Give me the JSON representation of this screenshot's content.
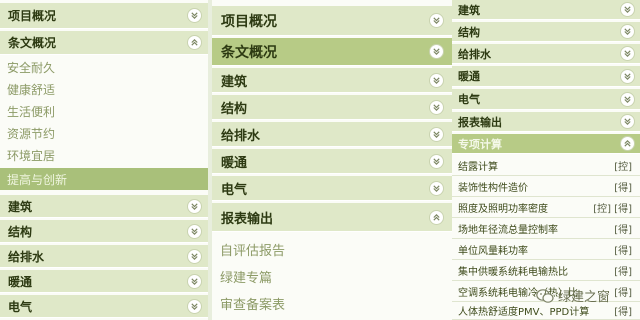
{
  "panel_left": {
    "project_overview": "项目概况",
    "clauses_overview": "条文概况",
    "clause_items": [
      "安全耐久",
      "健康舒适",
      "生活便利",
      "资源节约",
      "环境宜居",
      "提高与创新"
    ],
    "sections": [
      "建筑",
      "结构",
      "给排水",
      "暖通",
      "电气"
    ]
  },
  "panel_middle": {
    "project_overview": "项目概况",
    "clauses_overview": "条文概况",
    "sections": [
      "建筑",
      "结构",
      "给排水",
      "暖通",
      "电气"
    ],
    "report_output": "报表输出",
    "report_items": [
      "自评估报告",
      "绿建专篇",
      "审查备案表"
    ]
  },
  "panel_right": {
    "sections": [
      "建筑",
      "结构",
      "给排水",
      "暖通",
      "电气"
    ],
    "report_output": "报表输出",
    "special_calc": "专项计算",
    "calc_items": [
      {
        "label": "结露计算",
        "tag": "[控]"
      },
      {
        "label": "装饰性构件造价",
        "tag": "[得]"
      },
      {
        "label": "照度及照明功率密度",
        "tag": "[控] [得]"
      },
      {
        "label": "场地年径流总量控制率",
        "tag": "[得]"
      },
      {
        "label": "单位风量耗功率",
        "tag": "[得]"
      },
      {
        "label": "集中供暖系统耗电输热比",
        "tag": "[得]"
      },
      {
        "label": "空调系统耗电输冷（热）比",
        "tag": "[得]"
      },
      {
        "label": "人体热舒适度PMV、PPD计算",
        "tag": "[得]"
      }
    ]
  },
  "watermark": {
    "text": "绿建之窗"
  }
}
